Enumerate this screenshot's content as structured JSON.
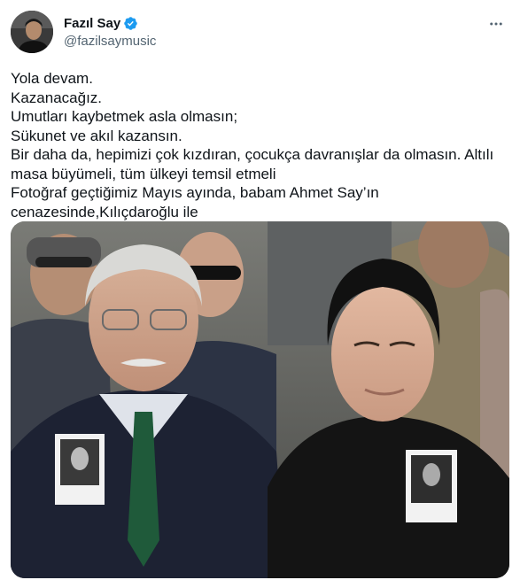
{
  "author": {
    "display_name": "Fazıl Say",
    "handle": "@fazilsaymusic",
    "verified": true,
    "avatar_icon": "profile-photo",
    "verified_icon": "verified-badge-icon",
    "verified_color": "#1d9bf0"
  },
  "menu": {
    "more_icon": "more-horizontal-icon"
  },
  "tweet": {
    "lines": [
      "Yola devam.",
      "Kazanacağız.",
      "Umutları kaybetmek asla olmasın;",
      "Sükunet ve akıl kazansın.",
      "Bir daha da, hepimizi çok kızdıran, çocukça davranışlar da olmasın. Altılı masa büyümeli, tüm ülkeyi temsil etmeli",
      "Fotoğraf geçtiğimiz Mayıs ayında, babam Ahmet Say’ın cenazesinde,Kılıçdaroğlu ile"
    ]
  },
  "media": {
    "type": "photo",
    "icon": "photo-two-men-at-funeral"
  },
  "colors": {
    "text": "#0f1419",
    "secondary": "#536471",
    "accent": "#1d9bf0"
  }
}
